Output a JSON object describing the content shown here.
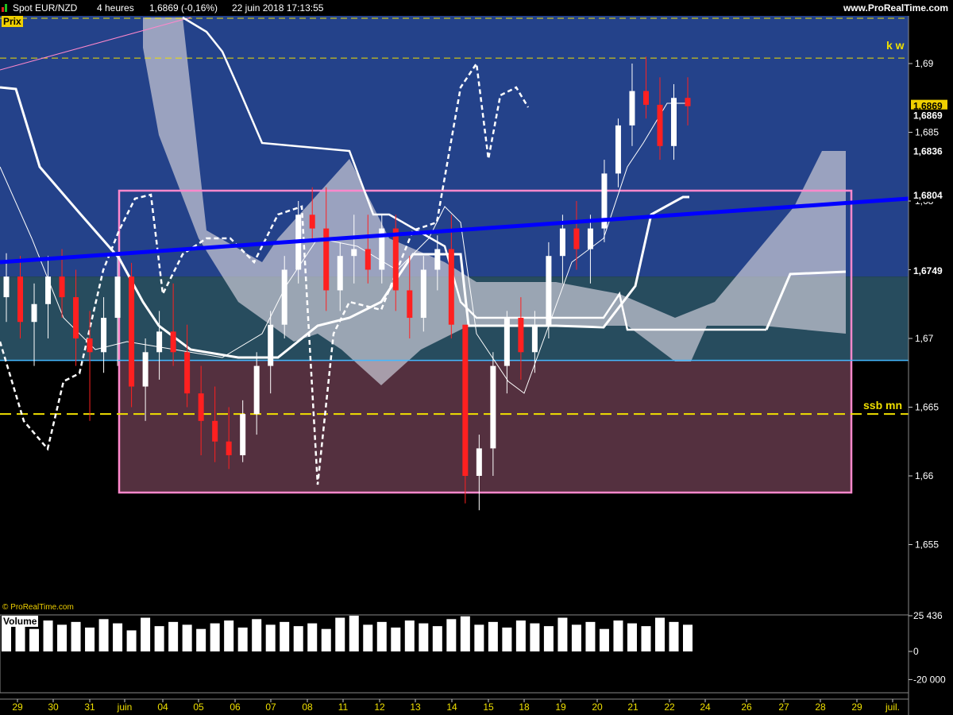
{
  "header": {
    "title": "Spot EUR/NZD",
    "period": "4 heures",
    "last": "1,6869 (-0,16%)",
    "datetime": "22 juin 2018 17:13:55",
    "brand": "www.ProRealTime.com"
  },
  "panel_labels": {
    "price": "Prix",
    "volume": "Volume",
    "copyright": "© ProRealTime.com"
  },
  "annotations": {
    "kw": "k w",
    "ssb": "ssb mn"
  },
  "price_axis": {
    "ticks": [
      "1,69",
      "1,685",
      "1,68",
      "1,675",
      "1,67",
      "1,665",
      "1,66",
      "1,655"
    ],
    "tick_values": [
      1.69,
      1.685,
      1.68,
      1.675,
      1.67,
      1.665,
      1.66,
      1.655
    ],
    "badges": [
      {
        "text": "1,6869",
        "value": 1.6869,
        "bg": "#f0d000",
        "fg": "#000000"
      },
      {
        "text": "1,6869",
        "value": 1.6862,
        "bg": "#000000",
        "fg": "#ffffff"
      },
      {
        "text": "1,6836",
        "value": 1.6836,
        "bg": "#000000",
        "fg": "#ffffff"
      },
      {
        "text": "1,6804",
        "value": 1.6804,
        "bg": "#000000",
        "fg": "#ffffff"
      },
      {
        "text": "1,6749",
        "value": 1.6749,
        "bg": "#000000",
        "fg": "#ffffff"
      }
    ]
  },
  "volume_axis": {
    "ticks": [
      "25 436",
      "0",
      "-20 000"
    ],
    "tick_values": [
      25436,
      0,
      -20000
    ]
  },
  "x_axis": {
    "labels": [
      "29",
      "30",
      "31",
      "juin",
      "04",
      "05",
      "06",
      "07",
      "08",
      "11",
      "12",
      "13",
      "14",
      "15",
      "18",
      "19",
      "20",
      "21",
      "22",
      "24",
      "26",
      "27",
      "28",
      "29",
      "juil."
    ]
  },
  "colors": {
    "upper_bg": "#24428a",
    "lower_bg": "#54303f",
    "mid_bg": "#274c5e",
    "trendline": "#0000ff",
    "box": "#ff88cc",
    "bull": "#ffffff",
    "bear": "#ff2020",
    "hline_cyan": "#44b8ff",
    "hline_yellow": "#f0e000"
  },
  "chart_data": {
    "type": "candlestick",
    "timeframe": "4 heures",
    "ylim": [
      1.651,
      1.6915
    ],
    "levels": [
      {
        "name": "k w",
        "value": 1.6904
      },
      {
        "name": "ssb mn",
        "value": 1.6645
      },
      {
        "value": 1.6684
      }
    ],
    "candles_ohlc": [
      [
        1.673,
        1.6762,
        1.6712,
        1.6745
      ],
      [
        1.6745,
        1.676,
        1.67,
        1.6712
      ],
      [
        1.6712,
        1.674,
        1.668,
        1.6725
      ],
      [
        1.6725,
        1.676,
        1.67,
        1.6745
      ],
      [
        1.6745,
        1.6765,
        1.6715,
        1.673
      ],
      [
        1.673,
        1.675,
        1.668,
        1.67
      ],
      [
        1.67,
        1.672,
        1.664,
        1.669
      ],
      [
        1.669,
        1.673,
        1.6675,
        1.6715
      ],
      [
        1.6715,
        1.676,
        1.668,
        1.6745
      ],
      [
        1.6745,
        1.6755,
        1.665,
        1.6665
      ],
      [
        1.6665,
        1.67,
        1.664,
        1.669
      ],
      [
        1.669,
        1.672,
        1.667,
        1.6705
      ],
      [
        1.6705,
        1.674,
        1.668,
        1.669
      ],
      [
        1.669,
        1.671,
        1.665,
        1.666
      ],
      [
        1.666,
        1.668,
        1.6615,
        1.664
      ],
      [
        1.664,
        1.6665,
        1.661,
        1.6625
      ],
      [
        1.6625,
        1.665,
        1.6605,
        1.6615
      ],
      [
        1.6615,
        1.6655,
        1.661,
        1.6645
      ],
      [
        1.6645,
        1.669,
        1.663,
        1.668
      ],
      [
        1.668,
        1.672,
        1.666,
        1.671
      ],
      [
        1.671,
        1.676,
        1.67,
        1.675
      ],
      [
        1.675,
        1.68,
        1.674,
        1.679
      ],
      [
        1.679,
        1.681,
        1.677,
        1.678
      ],
      [
        1.678,
        1.681,
        1.672,
        1.6735
      ],
      [
        1.6735,
        1.677,
        1.672,
        1.676
      ],
      [
        1.676,
        1.679,
        1.674,
        1.6765
      ],
      [
        1.6765,
        1.679,
        1.674,
        1.675
      ],
      [
        1.675,
        1.679,
        1.674,
        1.678
      ],
      [
        1.678,
        1.679,
        1.672,
        1.6735
      ],
      [
        1.6735,
        1.676,
        1.67,
        1.6715
      ],
      [
        1.6715,
        1.676,
        1.6705,
        1.675
      ],
      [
        1.675,
        1.6775,
        1.6735,
        1.6765
      ],
      [
        1.6765,
        1.679,
        1.67,
        1.671
      ],
      [
        1.671,
        1.668,
        1.658,
        1.66
      ],
      [
        1.66,
        1.663,
        1.6575,
        1.662
      ],
      [
        1.662,
        1.669,
        1.66,
        1.668
      ],
      [
        1.668,
        1.672,
        1.666,
        1.6715
      ],
      [
        1.6715,
        1.673,
        1.667,
        1.669
      ],
      [
        1.669,
        1.672,
        1.6675,
        1.671
      ],
      [
        1.671,
        1.677,
        1.67,
        1.676
      ],
      [
        1.676,
        1.679,
        1.674,
        1.678
      ],
      [
        1.678,
        1.68,
        1.675,
        1.6765
      ],
      [
        1.6765,
        1.679,
        1.674,
        1.678
      ],
      [
        1.678,
        1.683,
        1.677,
        1.682
      ],
      [
        1.682,
        1.686,
        1.681,
        1.6855
      ],
      [
        1.6855,
        1.69,
        1.684,
        1.688
      ],
      [
        1.688,
        1.6905,
        1.686,
        1.687
      ],
      [
        1.687,
        1.689,
        1.683,
        1.684
      ],
      [
        1.684,
        1.6885,
        1.683,
        1.6875
      ],
      [
        1.6875,
        1.689,
        1.6855,
        1.6869
      ]
    ],
    "volume": [
      18000,
      20000,
      16000,
      22000,
      19000,
      21000,
      17000,
      23000,
      20000,
      15000,
      24000,
      18000,
      21000,
      19000,
      16000,
      20000,
      22000,
      17000,
      23000,
      19000,
      21000,
      18000,
      20000,
      16000,
      24000,
      25436,
      19000,
      21000,
      17000,
      22000,
      20000,
      18000,
      23000,
      25000,
      19000,
      21000,
      17000,
      22000,
      20000,
      18000,
      24000,
      19000,
      21000,
      16000,
      22000,
      20000,
      18000,
      24000,
      21000,
      19000
    ]
  }
}
